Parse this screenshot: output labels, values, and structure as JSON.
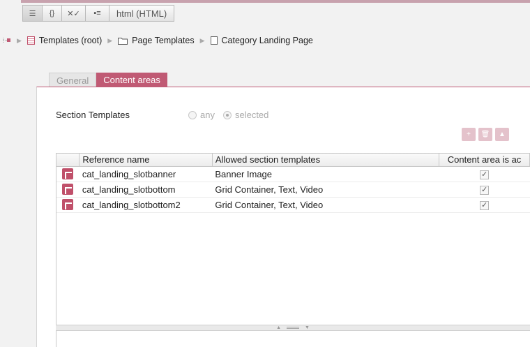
{
  "toolbar": {
    "buttons": [
      {
        "icon": "properties-view-icon",
        "glyph": "☰"
      },
      {
        "icon": "structure-view-icon",
        "glyph": "{}"
      },
      {
        "icon": "validate-icon",
        "glyph": "✕✓"
      },
      {
        "icon": "form-view-icon",
        "glyph": "▪≡"
      }
    ],
    "mode_label": "html (HTML)"
  },
  "breadcrumb": {
    "items": [
      {
        "icon": "template-icon",
        "label": "Templates (root)"
      },
      {
        "icon": "folder-icon",
        "label": "Page Templates"
      },
      {
        "icon": "document-icon",
        "label": "Category Landing Page"
      }
    ]
  },
  "tabs": [
    {
      "label": "General",
      "active": false
    },
    {
      "label": "Content areas",
      "active": true
    }
  ],
  "section_templates": {
    "label": "Section Templates",
    "options": [
      {
        "label": "any",
        "checked": false
      },
      {
        "label": "selected",
        "checked": true
      }
    ]
  },
  "table_tools": [
    {
      "icon": "add-row-icon",
      "glyph": "+"
    },
    {
      "icon": "delete-icon",
      "glyph": "🗑"
    },
    {
      "icon": "move-up-icon",
      "glyph": "▲"
    }
  ],
  "table": {
    "columns": [
      "Reference name",
      "Allowed section templates",
      "Content area is ac"
    ],
    "rows": [
      {
        "ref": "cat_landing_slotbanner",
        "allowed": "Banner Image",
        "checked": true
      },
      {
        "ref": "cat_landing_slotbottom",
        "allowed": "Grid Container, Text, Video",
        "checked": true
      },
      {
        "ref": "cat_landing_slotbottom2",
        "allowed": "Grid Container, Text, Video",
        "checked": true
      }
    ]
  },
  "colors": {
    "accent": "#c05a74",
    "accent_light": "#e4c2cb"
  }
}
